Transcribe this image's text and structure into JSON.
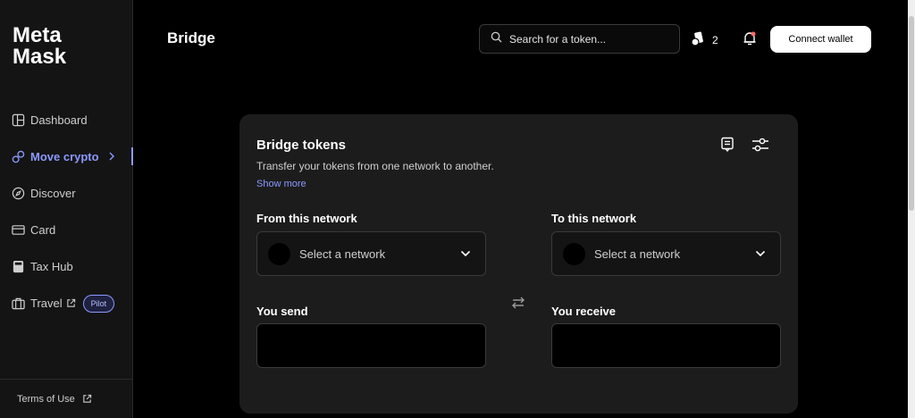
{
  "logo": {
    "line1": "Meta",
    "line2": "Mask"
  },
  "sidebar": {
    "items": [
      {
        "label": "Dashboard",
        "icon": "dashboard-icon"
      },
      {
        "label": "Move crypto",
        "icon": "move-crypto-icon",
        "active": true
      },
      {
        "label": "Discover",
        "icon": "compass-icon"
      },
      {
        "label": "Card",
        "icon": "card-icon"
      },
      {
        "label": "Tax Hub",
        "icon": "calculator-icon"
      },
      {
        "label": "Travel",
        "icon": "suitcase-icon",
        "badge": "Pilot"
      }
    ],
    "terms": "Terms of Use"
  },
  "header": {
    "title": "Bridge",
    "search_placeholder": "Search for a token...",
    "wallet_count": "2",
    "connect_label": "Connect wallet"
  },
  "bridge": {
    "title": "Bridge tokens",
    "subtitle": "Transfer your tokens from one network to another.",
    "show_more": "Show more",
    "from_label": "From this network",
    "to_label": "To this network",
    "select_placeholder": "Select a network",
    "send_label": "You send",
    "receive_label": "You receive"
  },
  "colors": {
    "accent": "#8b99ff",
    "background": "#000000",
    "sidebar": "#141414",
    "card": "#1c1c1c"
  }
}
